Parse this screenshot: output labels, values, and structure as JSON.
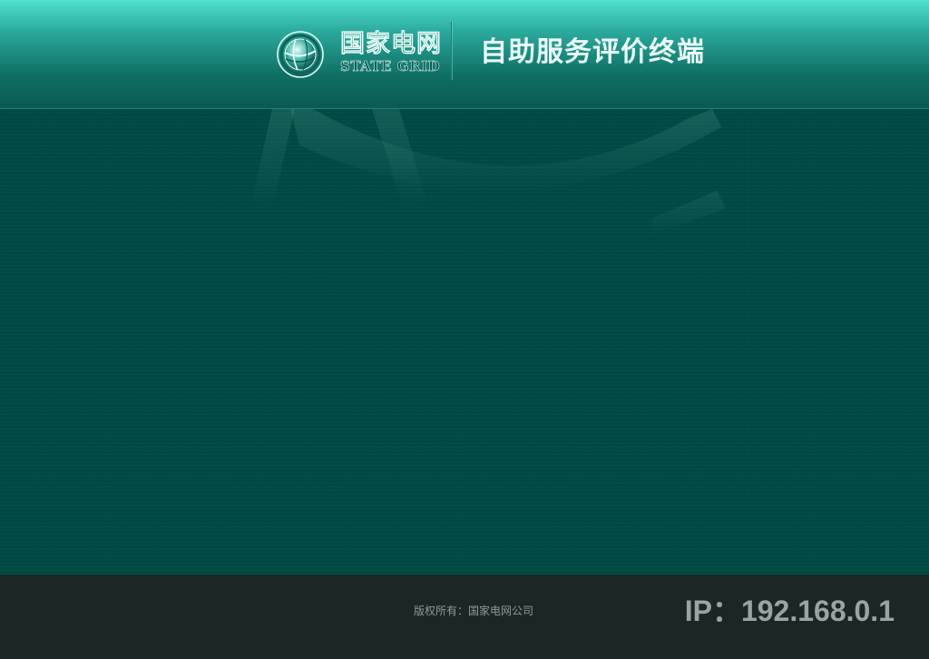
{
  "header": {
    "brand_cn": "国家电网",
    "brand_en": "STATE GRID",
    "app_title": "自助服务评价终端",
    "logo_icon": "state-grid-globe-logo"
  },
  "footer": {
    "copyright": "版权所有：国家电网公司",
    "ip_label": "IP：192.168.0.1"
  },
  "colors": {
    "header_top": "#4fe0cf",
    "header_bottom": "#0a5a52",
    "main_bg": "#014a44",
    "footer_bg": "#1a2726",
    "footer_text": "#8e9b99",
    "ip_text": "#9aa4a3"
  }
}
